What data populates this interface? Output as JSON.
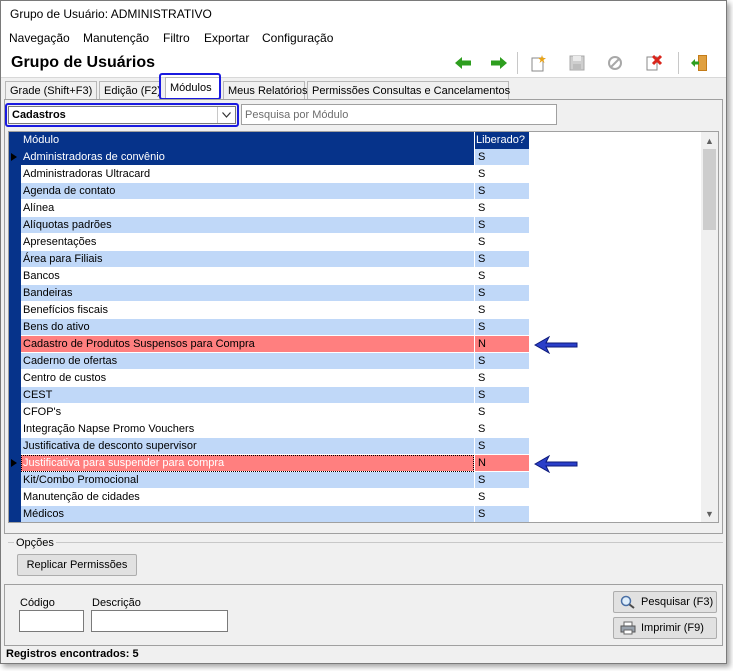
{
  "window": {
    "title": "Grupo de Usuário: ADMINISTRATIVO"
  },
  "menu": [
    "Navegação",
    "Manutenção",
    "Filtro",
    "Exportar",
    "Configuração"
  ],
  "header": {
    "title": "Grupo de Usuários"
  },
  "toolbar": {
    "icons": [
      "arrow-left-icon",
      "arrow-right-icon",
      "new-icon",
      "save-icon",
      "cancel-icon",
      "delete-icon",
      "exit-icon"
    ],
    "colors": {
      "nav_arrows": "#2e9e1f",
      "new": "#e8a319",
      "delete": "#d9261c",
      "exit": "#c47c18"
    }
  },
  "tabs": [
    "Grade (Shift+F3)",
    "Edição (F2)",
    "Módulos",
    "Meus Relatórios",
    "Permissões Consultas e Cancelamentos"
  ],
  "active_tab": "Módulos",
  "module_select": {
    "value": "Cadastros"
  },
  "search": {
    "placeholder": "Pesquisa por Módulo"
  },
  "grid": {
    "columns": [
      "Módulo",
      "Liberado?"
    ],
    "colors": {
      "header": "#06338a",
      "selected": "#06338a",
      "alt": "#c0d8f8",
      "highlight": "#ff7f7f"
    },
    "rows": [
      {
        "modulo": "Administradoras de convênio",
        "liberado": "S",
        "style": "selected"
      },
      {
        "modulo": "Administradoras Ultracard",
        "liberado": "S",
        "style": "white"
      },
      {
        "modulo": "Agenda de contato",
        "liberado": "S",
        "style": "alt"
      },
      {
        "modulo": "Alínea",
        "liberado": "S",
        "style": "white"
      },
      {
        "modulo": "Alíquotas padrões",
        "liberado": "S",
        "style": "alt"
      },
      {
        "modulo": "Apresentações",
        "liberado": "S",
        "style": "white"
      },
      {
        "modulo": "Área para Filiais",
        "liberado": "S",
        "style": "alt"
      },
      {
        "modulo": "Bancos",
        "liberado": "S",
        "style": "white"
      },
      {
        "modulo": "Bandeiras",
        "liberado": "S",
        "style": "alt"
      },
      {
        "modulo": "Benefícios fiscais",
        "liberado": "S",
        "style": "white"
      },
      {
        "modulo": "Bens do ativo",
        "liberado": "S",
        "style": "alt"
      },
      {
        "modulo": "Cadastro de Produtos Suspensos para Compra",
        "liberado": "N",
        "style": "red"
      },
      {
        "modulo": "Caderno de ofertas",
        "liberado": "S",
        "style": "alt"
      },
      {
        "modulo": "Centro de custos",
        "liberado": "S",
        "style": "white"
      },
      {
        "modulo": "CEST",
        "liberado": "S",
        "style": "alt"
      },
      {
        "modulo": "CFOP's",
        "liberado": "S",
        "style": "white"
      },
      {
        "modulo": "Integração Napse Promo Vouchers",
        "liberado": "S",
        "style": "white"
      },
      {
        "modulo": "Justificativa de desconto supervisor",
        "liberado": "S",
        "style": "alt"
      },
      {
        "modulo": "Justificativa para suspender para compra",
        "liberado": "N",
        "style": "red"
      },
      {
        "modulo": "Kit/Combo Promocional",
        "liberado": "S",
        "style": "alt"
      },
      {
        "modulo": "Manutenção de cidades",
        "liberado": "S",
        "style": "white"
      },
      {
        "modulo": "Médicos",
        "liberado": "S",
        "style": "alt"
      }
    ]
  },
  "options": {
    "label": "Opções",
    "replicate_button": "Replicar Permissões"
  },
  "filters": {
    "codigo_label": "Código",
    "descricao_label": "Descrição"
  },
  "buttons": {
    "search": "Pesquisar (F3)",
    "print": "Imprimir (F9)"
  },
  "status": {
    "text": "Registros encontrados: 5"
  }
}
